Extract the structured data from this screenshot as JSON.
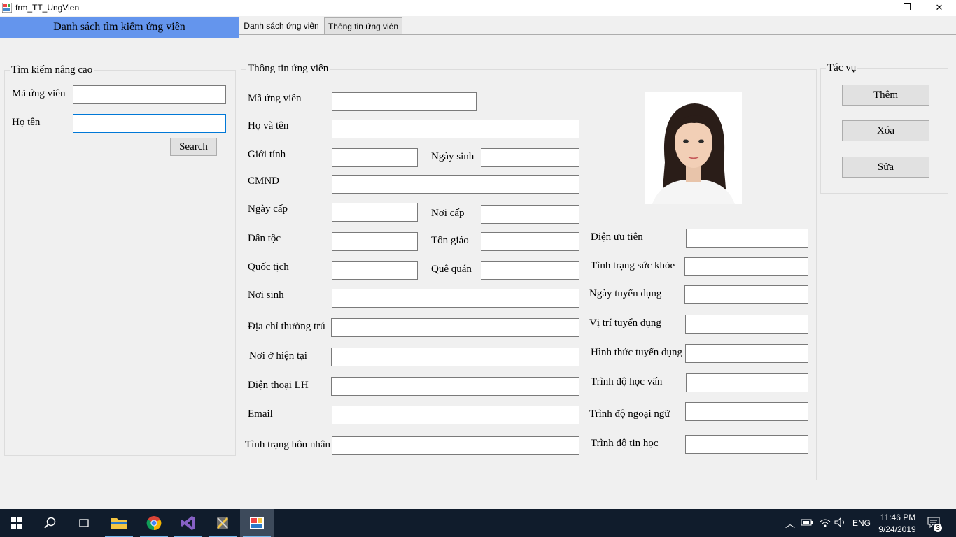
{
  "window": {
    "title": "frm_TT_UngVien",
    "controls": {
      "minimize": "—",
      "restore": "❐",
      "close": "✕"
    }
  },
  "left_panel": {
    "header": "Danh sách tìm kiếm ứng viên",
    "search_group": {
      "legend": "Tìm kiếm nâng cao",
      "ma_label": "Mã ứng viên",
      "ma_value": "",
      "hoten_label": "Họ tên",
      "hoten_value": "",
      "search_button": "Search"
    }
  },
  "tabs": [
    {
      "label": "Danh sách ứng viên",
      "active": false
    },
    {
      "label": "Thông tin ứng viên",
      "active": true
    }
  ],
  "info_group": {
    "legend": "Thông tin ứng viên",
    "labels": {
      "ma_ung_vien": "Mã ứng viên",
      "ho_va_ten": "Họ và tên",
      "gioi_tinh": "Giới tính",
      "ngay_sinh": "Ngày sinh",
      "cmnd": "CMND",
      "ngay_cap": "Ngày cấp",
      "noi_cap": "Nơi cấp",
      "dan_toc": "Dân tộc",
      "ton_giao": "Tôn giáo",
      "quoc_tich": "Quốc tịch",
      "que_quan": "Quê quán",
      "noi_sinh": "Nơi sinh",
      "dia_chi_thuong_tru": "Địa chỉ thường trú",
      "noi_o_hien_tai": "Nơi ở hiện tại",
      "dien_thoai_lh": "Điện thoại LH",
      "email": "Email",
      "tinh_trang_hon_nhan": "Tình trạng hôn nhân",
      "dien_uu_tien": "Diện ưu tiên",
      "tinh_trang_suc_khoe": "Tình trạng sức khỏe",
      "ngay_tuyen_dung": "Ngày tuyển dụng",
      "vi_tri_tuyen_dung": "Vị trí tuyển dụng",
      "hinh_thuc_tuyen_dung": "Hình thức tuyển dụng",
      "trinh_do_hoc_van": "Trình độ học vấn",
      "trinh_do_ngoai_ngu": "Trình độ ngoại ngữ",
      "trinh_do_tin_hoc": "Trình độ tin học"
    }
  },
  "actions_group": {
    "legend": "Tác vụ",
    "them": "Thêm",
    "xoa": "Xóa",
    "sua": "Sửa"
  },
  "taskbar": {
    "language": "ENG",
    "time": "11:46 PM",
    "date": "9/24/2019",
    "notification_count": "3"
  }
}
